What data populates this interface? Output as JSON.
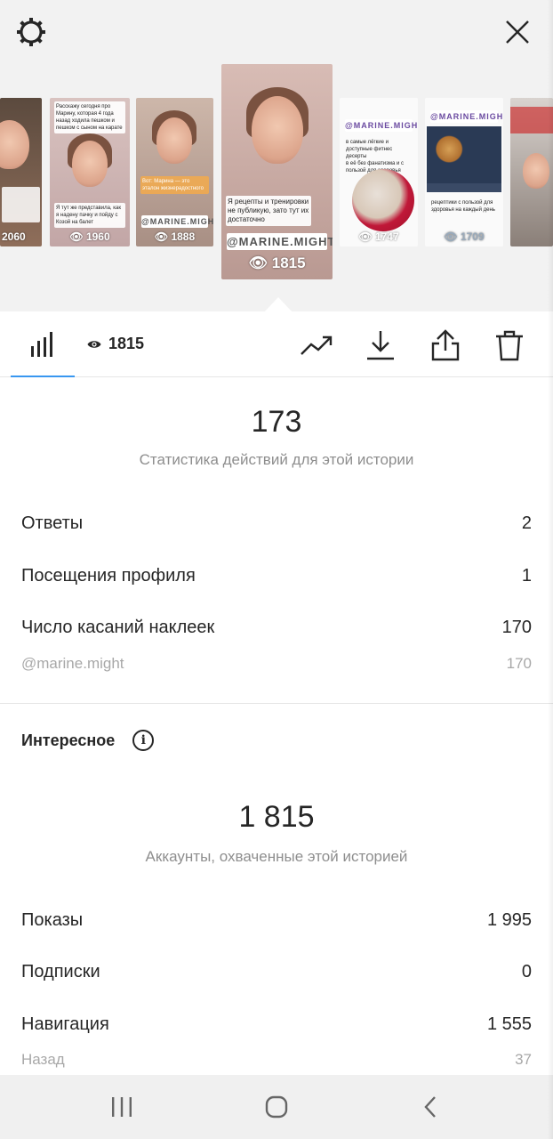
{
  "header": {
    "settings_icon": "gear-icon",
    "close_icon": "close-icon"
  },
  "stories": [
    {
      "views": "2060"
    },
    {
      "views": "1960",
      "caption_top": "Расскажу сегодня про Марину, которая 4 года назад ходила пешком и пешком с сыном на карате",
      "caption_mid": "Я тут же представила, как я надену пачку и пойду с Козой на балет"
    },
    {
      "views": "1888",
      "caption_top": "Вот: Марина — это эталон жизнерадостного",
      "tag": "@MARINE.MIGHT"
    },
    {
      "views": "1815",
      "caption_mid": "Я рецепты и тренировки не публикую, зато тут их достаточно",
      "tag": "@MARINE.MIGHT",
      "selected": true
    },
    {
      "views": "1747",
      "tag": "@MARINE.MIGHT",
      "caption_top": "в самые лёгкие и доступные фитнес десерты\nв её без фанатизма и с пользой для здоровья"
    },
    {
      "views": "1709",
      "tag": "@MARINE.MIGHT",
      "caption_mid": "рецептики с пользой для здоровья на каждый день"
    },
    {
      "views": ""
    }
  ],
  "tabbar": {
    "views_count": "1815",
    "tools": [
      "trending-icon",
      "download-icon",
      "share-icon",
      "delete-icon"
    ]
  },
  "actions": {
    "total": "173",
    "subtitle": "Статистика действий для этой истории",
    "rows": [
      {
        "label": "Ответы",
        "value": "2"
      },
      {
        "label": "Посещения профиля",
        "value": "1"
      },
      {
        "label": "Число касаний наклеек",
        "value": "170"
      }
    ],
    "sub_row": {
      "label": "@marine.might",
      "value": "170"
    }
  },
  "discovery": {
    "title": "Интересное",
    "reach": "1 815",
    "subtitle": "Аккаунты, охваченные этой историей",
    "rows": [
      {
        "label": "Показы",
        "value": "1 995"
      },
      {
        "label": "Подписки",
        "value": "0"
      },
      {
        "label": "Навигация",
        "value": "1 555"
      }
    ],
    "sub_row": {
      "label": "Назад",
      "value": "37"
    }
  },
  "colors": {
    "accent": "#3897f0",
    "text": "#262626",
    "muted": "#8e8e8e"
  }
}
